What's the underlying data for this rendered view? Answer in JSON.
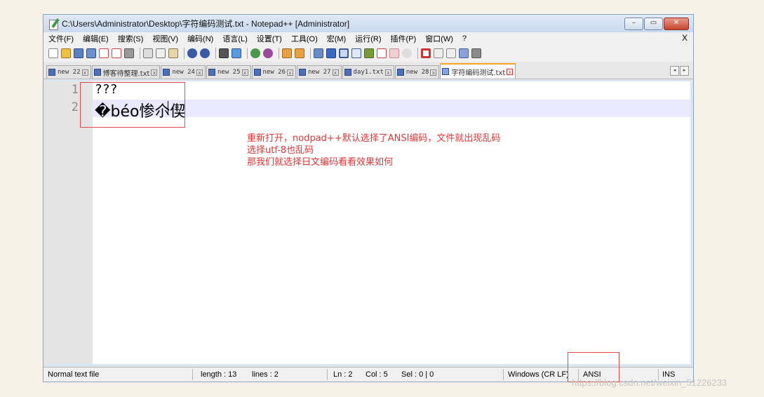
{
  "window": {
    "title": "C:\\Users\\Administrator\\Desktop\\字符编码测试.txt - Notepad++ [Administrator]",
    "controls": {
      "minimize": "–",
      "maximize": "▭",
      "close": "✕"
    }
  },
  "menu": {
    "items": [
      "文件(F)",
      "编辑(E)",
      "搜索(S)",
      "视图(V)",
      "编码(N)",
      "语言(L)",
      "设置(T)",
      "工具(O)",
      "宏(M)",
      "运行(R)",
      "插件(P)",
      "窗口(W)",
      "?"
    ],
    "close_label": "X"
  },
  "tabs": [
    {
      "label": "new 22",
      "active": false
    },
    {
      "label": "博客待整理.txt",
      "active": false
    },
    {
      "label": "new 24",
      "active": false
    },
    {
      "label": "new 25",
      "active": false
    },
    {
      "label": "new 26",
      "active": false
    },
    {
      "label": "new 27",
      "active": false
    },
    {
      "label": "day1.txt",
      "active": false
    },
    {
      "label": "new 28",
      "active": false
    },
    {
      "label": "字符编码测试.txt",
      "active": true
    }
  ],
  "tab_nav": {
    "prev": "◂",
    "next": "▸"
  },
  "editor": {
    "lines": [
      {
        "number": "1",
        "text": "???"
      },
      {
        "number": "2",
        "text": "�béo惨尒偰"
      }
    ]
  },
  "annotation": {
    "lines": [
      "重新打开，nodpad++默认选择了ANSI编码，文件就出现乱码",
      "选择utf-8也乱码",
      "那我们就选择日文编码看看效果如何"
    ],
    "color": "#e53333"
  },
  "status": {
    "file_type": "Normal text file",
    "length": "length : 13",
    "lines": "lines : 2",
    "ln": "Ln : 2",
    "col": "Col : 5",
    "sel": "Sel : 0 | 0",
    "eol": "Windows (CR LF)",
    "encoding": "ANSI",
    "mode": "INS"
  },
  "watermark": "https://blog.csdn.net/weixin_51226233"
}
